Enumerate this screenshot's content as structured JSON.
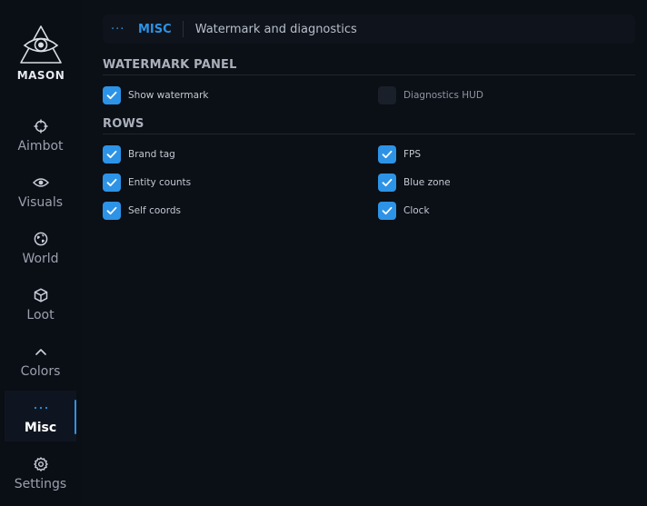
{
  "brand": {
    "name": "MASON"
  },
  "sidebar": {
    "items": [
      {
        "label": "Aimbot",
        "icon": "crosshair-icon",
        "active": false
      },
      {
        "label": "Visuals",
        "icon": "eye-icon",
        "active": false
      },
      {
        "label": "World",
        "icon": "globe-icon",
        "active": false
      },
      {
        "label": "Loot",
        "icon": "box-icon",
        "active": false
      },
      {
        "label": "Colors",
        "icon": "chevron-up-icon",
        "active": false
      },
      {
        "label": "Misc",
        "icon": "dots-icon",
        "active": true
      },
      {
        "label": "Settings",
        "icon": "gear-icon",
        "active": false
      }
    ]
  },
  "header": {
    "dots": "···",
    "section": "MISC",
    "subtitle": "Watermark and diagnostics"
  },
  "watermark_panel": {
    "title": "WATERMARK PANEL",
    "options": [
      {
        "label": "Show watermark",
        "checked": true
      },
      {
        "label": "Diagnostics HUD",
        "checked": false
      }
    ]
  },
  "rows": {
    "title": "ROWS",
    "options": [
      {
        "label": "Brand tag",
        "checked": true
      },
      {
        "label": "FPS",
        "checked": true
      },
      {
        "label": "Entity counts",
        "checked": true
      },
      {
        "label": "Blue zone",
        "checked": true
      },
      {
        "label": "Self coords",
        "checked": true
      },
      {
        "label": "Clock",
        "checked": true
      }
    ]
  },
  "colors": {
    "accent": "#2d93e6",
    "background": "#0b0f16",
    "checkbox_off": "#1a2029"
  }
}
